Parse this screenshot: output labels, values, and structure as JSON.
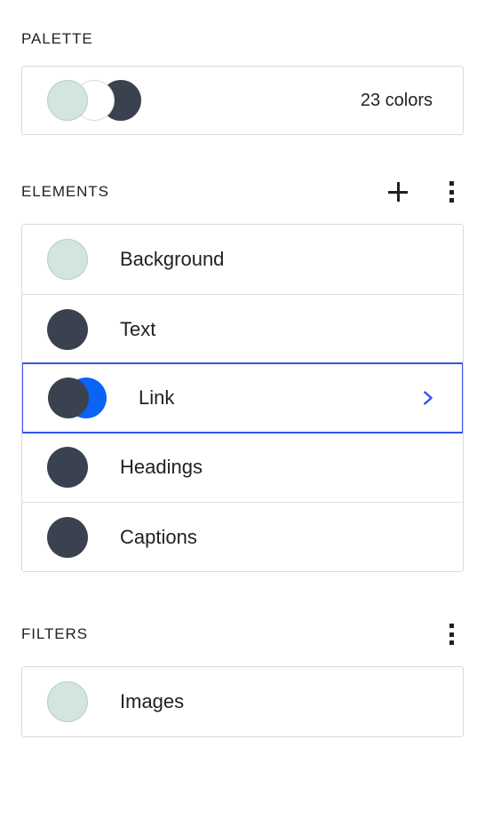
{
  "colors": {
    "mint": "#d3e5dd",
    "mint_border": "#b9cfc6",
    "white": "#ffffff",
    "white_border": "#dcdcdc",
    "navy": "#3a424f",
    "blue": "#0b63f6",
    "selection_border": "#3355ee",
    "chevron": "#3355ee",
    "card_border": "#d8dade",
    "divider": "#dfe1e5",
    "text": "#202124"
  },
  "palette": {
    "title": "PALETTE",
    "count_label": "23 colors",
    "swatches": [
      {
        "name": "swatch-mint",
        "color": "#d3e5dd",
        "border": "#b9cfc6"
      },
      {
        "name": "swatch-white",
        "color": "#ffffff",
        "border": "#dcdcdc"
      },
      {
        "name": "swatch-navy",
        "color": "#3a424f",
        "border": "#3a424f"
      }
    ]
  },
  "elements": {
    "title": "ELEMENTS",
    "add_icon": "plus-icon",
    "menu_icon": "kebab-menu-icon",
    "items": [
      {
        "label": "Background",
        "selected": false,
        "has_chevron": false,
        "swatch": {
          "type": "single",
          "front": "#d3e5dd",
          "front_border": "#b9cfc6"
        }
      },
      {
        "label": "Text",
        "selected": false,
        "has_chevron": false,
        "swatch": {
          "type": "single",
          "front": "#3a424f",
          "front_border": "#3a424f"
        }
      },
      {
        "label": "Link",
        "selected": true,
        "has_chevron": true,
        "chevron_icon": "chevron-right-icon",
        "swatch": {
          "type": "dual",
          "front": "#3a424f",
          "front_border": "#3a424f",
          "back": "#0b63f6",
          "back_border": "#0b63f6"
        }
      },
      {
        "label": "Headings",
        "selected": false,
        "has_chevron": false,
        "swatch": {
          "type": "single",
          "front": "#3a424f",
          "front_border": "#3a424f"
        }
      },
      {
        "label": "Captions",
        "selected": false,
        "has_chevron": false,
        "swatch": {
          "type": "single",
          "front": "#3a424f",
          "front_border": "#3a424f"
        }
      }
    ]
  },
  "filters": {
    "title": "FILTERS",
    "menu_icon": "kebab-menu-icon",
    "items": [
      {
        "label": "Images",
        "selected": false,
        "has_chevron": false,
        "swatch": {
          "type": "single",
          "front": "#d3e5dd",
          "front_border": "#b9cfc6"
        }
      }
    ]
  }
}
